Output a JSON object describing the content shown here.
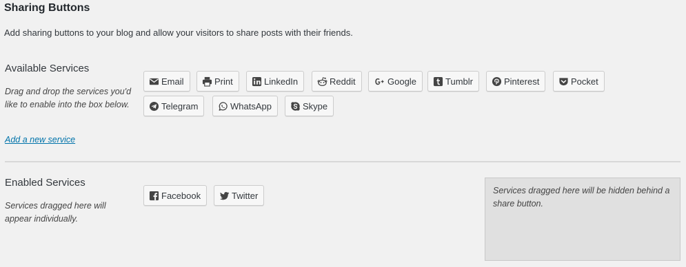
{
  "page": {
    "title": "Sharing Buttons",
    "description": "Add sharing buttons to your blog and allow your visitors to share posts with their friends."
  },
  "available": {
    "heading": "Available Services",
    "help": "Drag and drop the services you'd like to enable into the box below.",
    "add_link": "Add a new service",
    "services": [
      {
        "label": "Email",
        "icon": "mail-icon"
      },
      {
        "label": "Print",
        "icon": "printer-icon"
      },
      {
        "label": "LinkedIn",
        "icon": "linkedin-icon"
      },
      {
        "label": "Reddit",
        "icon": "reddit-icon"
      },
      {
        "label": "Google",
        "icon": "google-plus-icon"
      },
      {
        "label": "Tumblr",
        "icon": "tumblr-icon"
      },
      {
        "label": "Pinterest",
        "icon": "pinterest-icon"
      },
      {
        "label": "Pocket",
        "icon": "pocket-icon"
      },
      {
        "label": "Telegram",
        "icon": "telegram-icon"
      },
      {
        "label": "WhatsApp",
        "icon": "whatsapp-icon"
      },
      {
        "label": "Skype",
        "icon": "skype-icon"
      }
    ]
  },
  "enabled": {
    "heading": "Enabled Services",
    "help": "Services dragged here will appear individually.",
    "services": [
      {
        "label": "Facebook",
        "icon": "facebook-icon"
      },
      {
        "label": "Twitter",
        "icon": "twitter-icon"
      }
    ],
    "hidden_zone_text": "Services dragged here will be hidden behind a share button."
  }
}
